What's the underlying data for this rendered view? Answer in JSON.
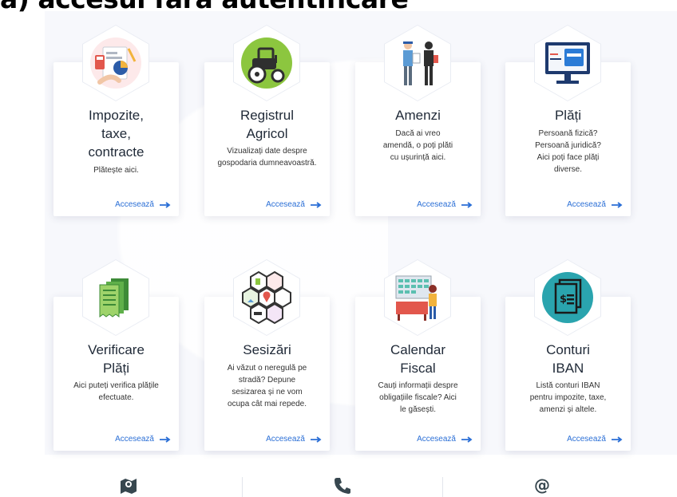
{
  "heading": "a) accesul fără autentificare",
  "cards": [
    {
      "title": "Impozite,\ntaxe,\ncontracte",
      "description": "Plătește aici.",
      "link": "Accesează",
      "icon": "tax-documents-icon"
    },
    {
      "title": "Registrul\nAgricol",
      "description": "Vizualizați date despre gospodaria dumneavoastră.",
      "link": "Accesează",
      "icon": "tractor-icon"
    },
    {
      "title": "Amenzi",
      "description": "Dacă ai vreo amendă, o poți plăti cu ușurință aici.",
      "link": "Accesează",
      "icon": "police-fine-icon"
    },
    {
      "title": "Plăți",
      "description": "Persoană fizică? Persoană juridică? Aici poți face plăți diverse.",
      "link": "Accesează",
      "icon": "payment-monitor-icon"
    },
    {
      "title": "Verificare\nPlăți",
      "description": "Aici puteți verifica plățile efectuate.",
      "link": "Accesează",
      "icon": "receipts-icon"
    },
    {
      "title": "Sesizări",
      "description": "Ai văzut o neregulă pe stradă? Depune sesizarea și ne vom ocupa cât mai repede.",
      "link": "Accesează",
      "icon": "city-report-icon"
    },
    {
      "title": "Calendar\nFiscal",
      "description": "Cauți informații despre obligațiile fiscale? Aici le găsești.",
      "link": "Accesează",
      "icon": "calendar-icon"
    },
    {
      "title": "Conturi\nIBAN",
      "description": "Listă conturi IBAN pentru impozite, taxe, amenzi și altele.",
      "link": "Accesează",
      "icon": "bank-accounts-icon"
    }
  ],
  "contact": {
    "map_icon": "map-icon",
    "phone_icon": "phone-icon",
    "at_symbol": "@"
  },
  "colors": {
    "link": "#2b6fd6",
    "heading": "#000000",
    "icon_dark": "#37474f"
  }
}
